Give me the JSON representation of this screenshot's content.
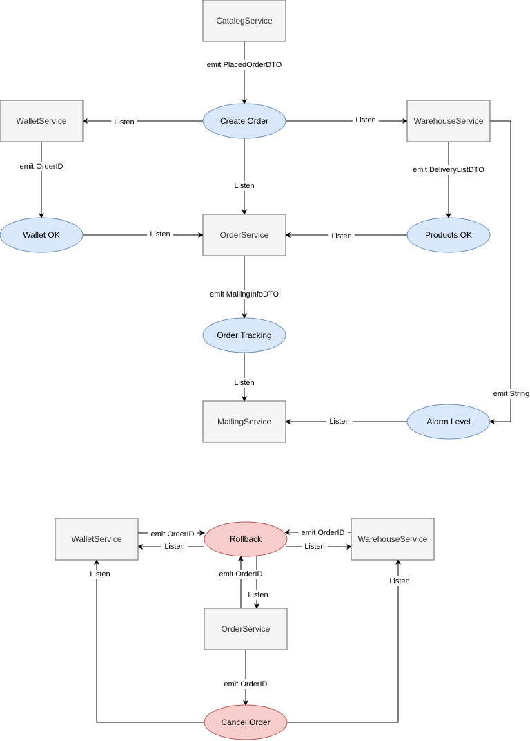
{
  "colors": {
    "service_fill": "#f5f5f5",
    "service_stroke": "#666666",
    "event_fill": "#dae8fc",
    "event_stroke": "#6c8ebf",
    "compensation_fill": "#f8cecc",
    "compensation_stroke": "#b85450"
  },
  "nodes": {
    "catalog": {
      "label": "CatalogService",
      "shape": "rect"
    },
    "create_order": {
      "label": "Create Order",
      "shape": "ellipse",
      "style": "event"
    },
    "wallet": {
      "label": "WalletService",
      "shape": "rect"
    },
    "warehouse": {
      "label": "WarehouseService",
      "shape": "rect"
    },
    "wallet_ok": {
      "label": "Wallet OK",
      "shape": "ellipse",
      "style": "event"
    },
    "order": {
      "label": "OrderService",
      "shape": "rect"
    },
    "products_ok": {
      "label": "Products OK",
      "shape": "ellipse",
      "style": "event"
    },
    "order_tracking": {
      "label": "Order Tracking",
      "shape": "ellipse",
      "style": "event"
    },
    "mailing": {
      "label": "MailingService",
      "shape": "rect"
    },
    "alarm_level": {
      "label": "Alarm Level",
      "shape": "ellipse",
      "style": "event"
    },
    "wallet2": {
      "label": "WalletService",
      "shape": "rect"
    },
    "rollback": {
      "label": "Rollback",
      "shape": "ellipse",
      "style": "compensation"
    },
    "warehouse2": {
      "label": "WarehouseService",
      "shape": "rect"
    },
    "order2": {
      "label": "OrderService",
      "shape": "rect"
    },
    "cancel_order": {
      "label": "Cancel Order",
      "shape": "ellipse",
      "style": "compensation"
    }
  },
  "edges": {
    "e1": {
      "from": "catalog",
      "to": "create_order",
      "label": "emit PlacedOrderDTO"
    },
    "e2": {
      "from": "create_order",
      "to": "wallet",
      "label": "Listen"
    },
    "e3": {
      "from": "create_order",
      "to": "warehouse",
      "label": "Listen"
    },
    "e4": {
      "from": "create_order",
      "to": "order",
      "label": "Listen"
    },
    "e5": {
      "from": "wallet",
      "to": "wallet_ok",
      "label": "emit OrderID"
    },
    "e6": {
      "from": "warehouse",
      "to": "products_ok",
      "label": "emit DeliveryListDTO"
    },
    "e7": {
      "from": "wallet_ok",
      "to": "order",
      "label": "Listen"
    },
    "e8": {
      "from": "products_ok",
      "to": "order",
      "label": "Listen"
    },
    "e9": {
      "from": "order",
      "to": "order_tracking",
      "label": "emit MailingInfoDTO"
    },
    "e10": {
      "from": "order_tracking",
      "to": "mailing",
      "label": "Listen"
    },
    "e11": {
      "from": "warehouse",
      "to": "alarm_level",
      "label": "emit String"
    },
    "e12": {
      "from": "alarm_level",
      "to": "mailing",
      "label": "Listen"
    },
    "e13": {
      "from": "wallet2",
      "to": "rollback",
      "label": "emit OrderID"
    },
    "e14": {
      "from": "rollback",
      "to": "wallet2",
      "label": "Listen"
    },
    "e15": {
      "from": "warehouse2",
      "to": "rollback",
      "label": "emit OrderID"
    },
    "e16": {
      "from": "rollback",
      "to": "warehouse2",
      "label": "Listen"
    },
    "e17": {
      "from": "order2",
      "to": "rollback",
      "label": "emit OrderID"
    },
    "e18": {
      "from": "rollback",
      "to": "order2",
      "label": "Listen"
    },
    "e19": {
      "from": "order2",
      "to": "cancel_order",
      "label": "emit OrderID"
    },
    "e20": {
      "from": "cancel_order",
      "to": "wallet2",
      "label": "Listen"
    },
    "e21": {
      "from": "cancel_order",
      "to": "warehouse2",
      "label": "Listen"
    }
  }
}
